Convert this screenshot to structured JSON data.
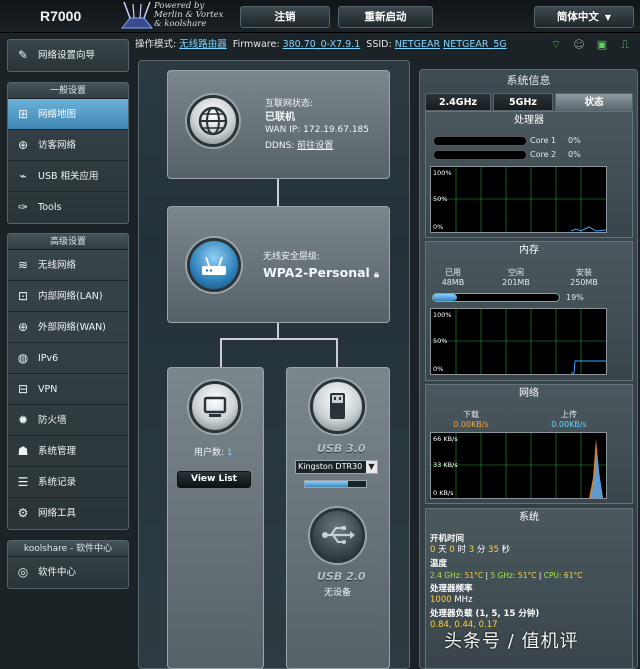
{
  "header": {
    "logo": "R7000",
    "powered_line1": "Powered by",
    "powered_line2": "Merlin & Vortex",
    "powered_line3": "& koolshare",
    "logout": "注销",
    "reboot": "重新启动",
    "language": "简体中文"
  },
  "statusbar": {
    "mode_label": "操作模式:",
    "mode_value": "无线路由器",
    "firmware_label": "Firmware:",
    "firmware_value": "380.70_0-X7.9.1",
    "ssid_label": "SSID:",
    "ssid1": "NETGEAR",
    "ssid2": "NETGEAR_5G"
  },
  "nav": {
    "wizard": "网络设置向导",
    "general_title": "一般设置",
    "general_items": [
      "网络地图",
      "访客网络",
      "USB 相关应用",
      "Tools"
    ],
    "advanced_title": "高级设置",
    "advanced_items": [
      "无线网络",
      "内部网络(LAN)",
      "外部网络(WAN)",
      "IPv6",
      "VPN",
      "防火墙",
      "系统管理",
      "系统记录",
      "网络工具"
    ],
    "koolshare_title": "koolshare - 软件中心",
    "koolshare_items": [
      "软件中心"
    ]
  },
  "map": {
    "internet_status_label": "互联网状态:",
    "internet_status_value": "已联机",
    "wan_ip_label": "WAN IP:",
    "wan_ip_value": "172.19.67.185",
    "ddns_label": "DDNS:",
    "ddns_value": "前往设置",
    "security_label": "无线安全层级:",
    "security_value": "WPA2-Personal",
    "clients_label": "用户数:",
    "clients_value": "1",
    "view_list": "View List",
    "usb3_title": "USB 3.0",
    "usb3_device": "Kingston DTR30",
    "usb3_usage_fraction": 0.7,
    "usb2_title": "USB 2.0",
    "usb2_status": "无设备"
  },
  "system": {
    "title": "系统信息",
    "tabs": [
      "2.4GHz",
      "5GHz",
      "状态"
    ],
    "cpu": {
      "title": "处理器",
      "cores": [
        {
          "name": "Core 1",
          "value": "0%"
        },
        {
          "name": "Core 2",
          "value": "0%"
        }
      ],
      "graph_labels": [
        "100%",
        "50%",
        "0%"
      ]
    },
    "memory": {
      "title": "内存",
      "used_label": "已用",
      "used_value": "48MB",
      "free_label": "空闲",
      "free_value": "201MB",
      "total_label": "安装",
      "total_value": "250MB",
      "percent": "19%",
      "percent_fraction": 0.19,
      "graph_labels": [
        "100%",
        "50%",
        "0%"
      ]
    },
    "network": {
      "title": "网络",
      "download_label": "下载",
      "download_value": "0.00KB/s",
      "upload_label": "上传",
      "upload_value": "0.00KB/s",
      "graph_labels": [
        "66 KB/s",
        "33 KB/s",
        "0 KB/s"
      ]
    },
    "sys": {
      "title": "系统",
      "uptime_label": "开机时间",
      "uptime": [
        {
          "n": "0",
          "u": "天"
        },
        {
          "n": "0",
          "u": "时"
        },
        {
          "n": "3",
          "u": "分"
        },
        {
          "n": "35",
          "u": "秒"
        }
      ],
      "temp_label": "温度",
      "temp_24_label": "2.4 GHz:",
      "temp_24_value": "51°C",
      "temp_5_label": "5 GHz:",
      "temp_5_value": "51°C",
      "temp_cpu_label": "CPU:",
      "temp_cpu_value": "61°C",
      "freq_label": "处理器频率",
      "freq_value": "1000",
      "freq_unit": "MHz",
      "load_label": "处理器负载 (1, 5, 15 分钟)",
      "load_value": "0.84,  0.44,  0.17"
    }
  },
  "watermark": "头条号 / 值机评"
}
